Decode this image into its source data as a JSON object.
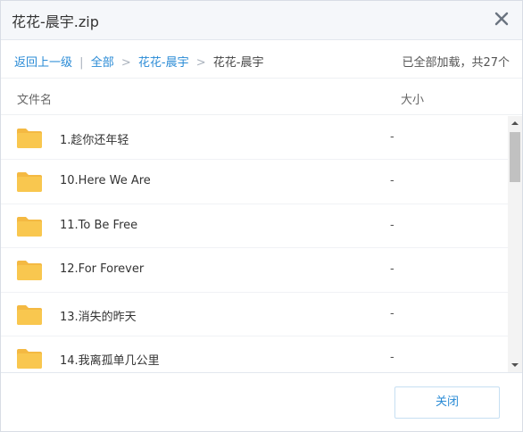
{
  "dialog": {
    "title": "花花-晨宇.zip",
    "close_icon": "close-icon"
  },
  "breadcrumb": {
    "back_label": "返回上一级",
    "divider": "|",
    "items": [
      "全部",
      "花花-晨宇"
    ],
    "current": "花花-晨宇",
    "separator": ">"
  },
  "load_status": "已全部加载，共27个",
  "columns": {
    "name": "文件名",
    "size": "大小"
  },
  "rows": [
    {
      "name": "1.趁你还年轻",
      "size": "-",
      "icon": "folder-icon"
    },
    {
      "name": "10.Here We Are",
      "size": "-",
      "icon": "folder-icon"
    },
    {
      "name": "11.To Be Free",
      "size": "-",
      "icon": "folder-icon"
    },
    {
      "name": "12.For Forever",
      "size": "-",
      "icon": "folder-icon"
    },
    {
      "name": "13.消失的昨天",
      "size": "-",
      "icon": "folder-icon"
    },
    {
      "name": "14.我离孤单几公里",
      "size": "-",
      "icon": "folder-icon"
    }
  ],
  "footer": {
    "close_label": "关闭"
  },
  "colors": {
    "link": "#2a8bd6",
    "folder": "#f9c74f",
    "folder_tab": "#f4b942"
  }
}
